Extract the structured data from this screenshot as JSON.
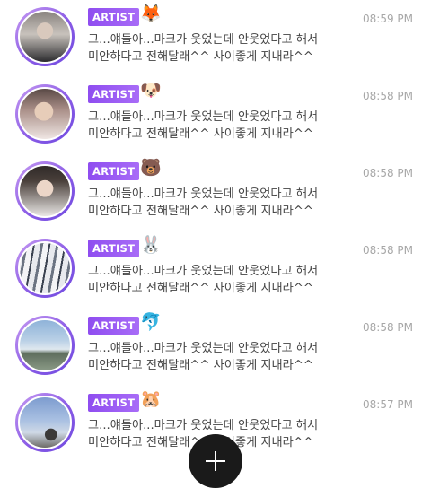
{
  "messages": [
    {
      "badge": "ARTIST",
      "emoji": "🦊",
      "emoji_name": "fox-icon",
      "time": "08:59 PM",
      "line1": "그...얘들아...마크가 웃었는데 안웃었다고 해서",
      "line2": "미안하다고 전해달래^^  사이좋게 지내라^^"
    },
    {
      "badge": "ARTIST",
      "emoji": "🐶",
      "emoji_name": "dog-icon",
      "time": "08:58 PM",
      "line1": "그...얘들아...마크가 웃었는데 안웃었다고 해서",
      "line2": "미안하다고 전해달래^^  사이좋게 지내라^^"
    },
    {
      "badge": "ARTIST",
      "emoji": "🐻",
      "emoji_name": "bear-icon",
      "time": "08:58 PM",
      "line1": "그...얘들아...마크가 웃었는데 안웃었다고 해서",
      "line2": "미안하다고 전해달래^^  사이좋게 지내라^^"
    },
    {
      "badge": "ARTIST",
      "emoji": "🐰",
      "emoji_name": "rabbit-icon",
      "time": "08:58 PM",
      "line1": "그...얘들아...마크가 웃었는데 안웃었다고 해서",
      "line2": "미안하다고 전해달래^^  사이좋게 지내라^^"
    },
    {
      "badge": "ARTIST",
      "emoji": "🐬",
      "emoji_name": "dolphin-icon",
      "time": "08:58 PM",
      "line1": "그...얘들아...마크가 웃었는데 안웃었다고 해서",
      "line2": "미안하다고 전해달래^^  사이좋게 지내라^^"
    },
    {
      "badge": "ARTIST",
      "emoji": "🐹",
      "emoji_name": "hamster-icon",
      "time": "08:57 PM",
      "line1": "그...얘들아...마크가 웃었는데 안웃었다고 해서",
      "line2": "미안하다고 전해달래^^  사이좋게 지내라^^"
    }
  ],
  "fab": {
    "icon": "plus-icon"
  },
  "colors": {
    "badge_start": "#8f4df0",
    "badge_end": "#a86cf7",
    "time": "#a7a7a7",
    "message": "#444444",
    "fab": "#1a1a1a"
  }
}
